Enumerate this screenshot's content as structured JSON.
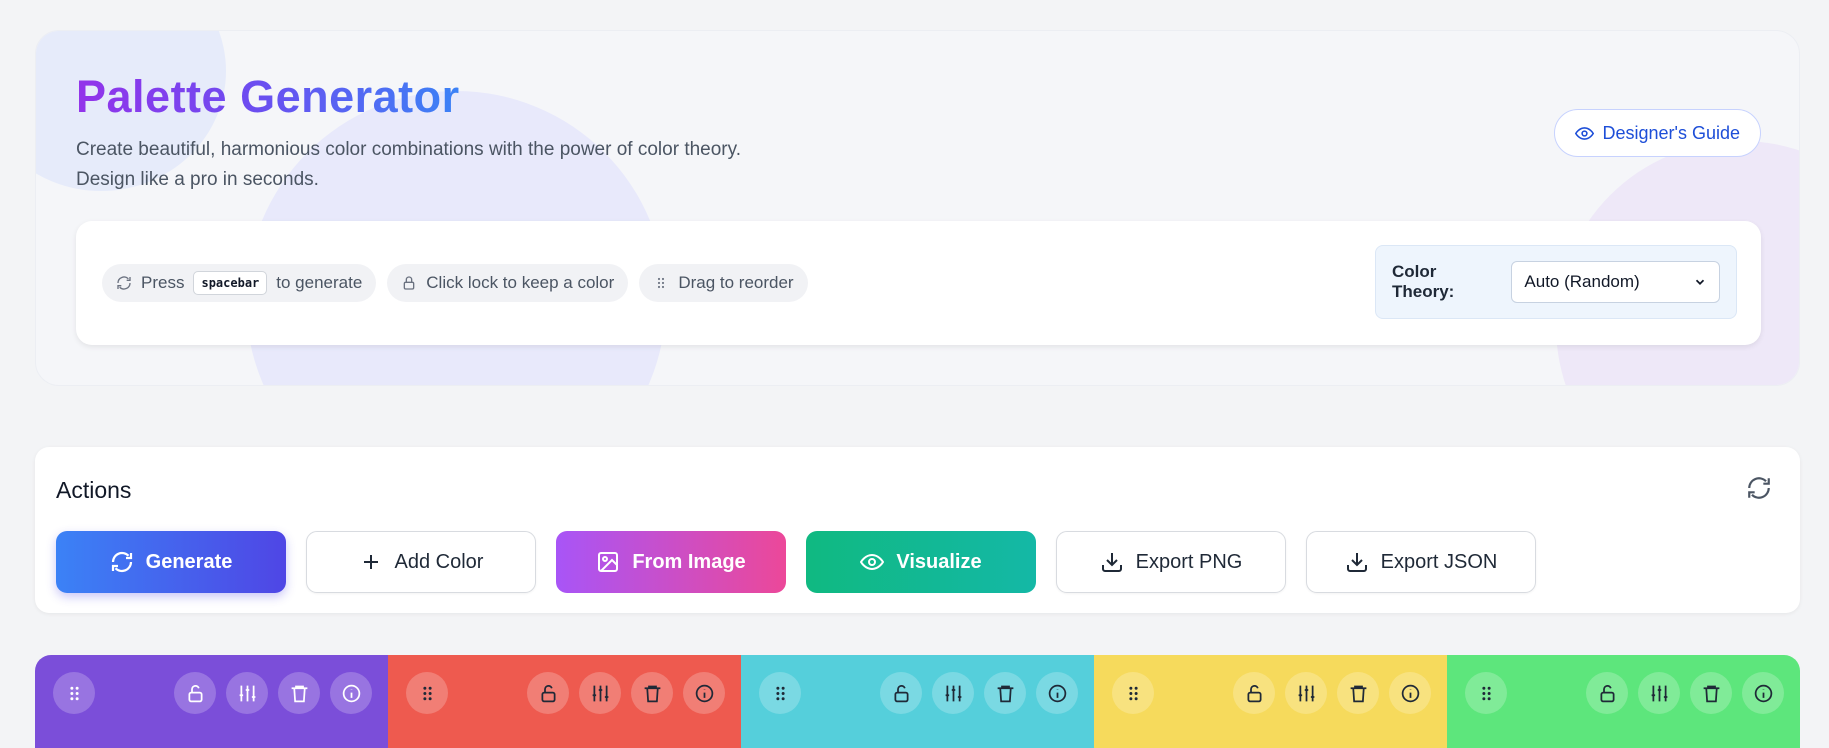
{
  "hero": {
    "title": "Palette Generator",
    "subtitle_line1": "Create beautiful, harmonious color combinations with the power of color theory.",
    "subtitle_line2": "Design like a pro in seconds.",
    "guide_button": "Designer's Guide"
  },
  "tips": {
    "generate_pre": "Press",
    "generate_key": "spacebar",
    "generate_post": "to generate",
    "lock": "Click lock to keep a color",
    "drag": "Drag to reorder"
  },
  "theory": {
    "label": "Color Theory:",
    "selected": "Auto (Random)"
  },
  "actions": {
    "title": "Actions",
    "generate": "Generate",
    "add_color": "Add Color",
    "from_image": "From Image",
    "visualize": "Visualize",
    "export_png": "Export PNG",
    "export_json": "Export JSON"
  },
  "swatches": [
    {
      "color": "#7b4ed9",
      "icon_color": "#ffffff"
    },
    {
      "color": "#ee5a4f",
      "icon_color": "#1f2937"
    },
    {
      "color": "#55cfdb",
      "icon_color": "#1f2937"
    },
    {
      "color": "#f6da5c",
      "icon_color": "#1f2937"
    },
    {
      "color": "#5de67c",
      "icon_color": "#1f2937"
    }
  ]
}
